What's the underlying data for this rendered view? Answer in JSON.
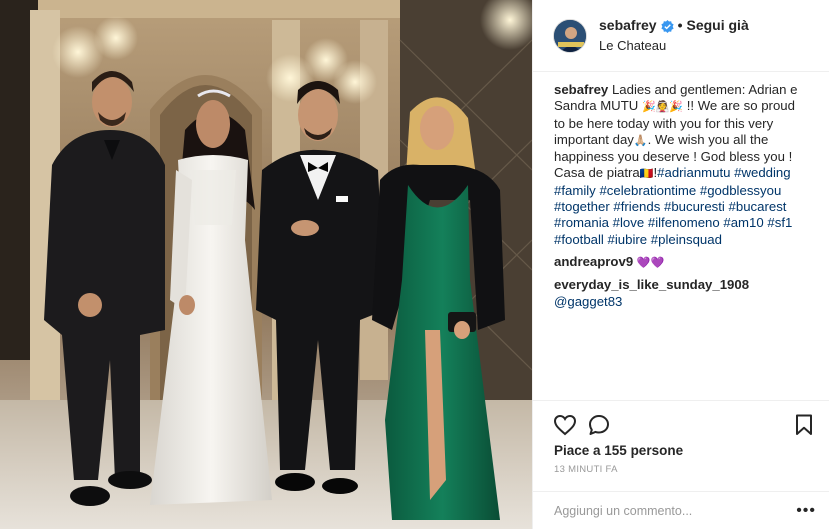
{
  "post": {
    "author": "sebafrey",
    "follow_label": "Segui già",
    "separator": "•",
    "location": "Le Chateau",
    "caption": {
      "author": "sebafrey",
      "line1": "Ladies and gentlemen: Adrian e",
      "line2_a": "Sandra MUTU ",
      "line2_emoji": "🎉👰🎉",
      "line2_b": " !! We are so proud",
      "line3": "to be here today with you for this very",
      "line4_a": "important day",
      "line4_emoji": "🙏🏼",
      "line4_b": ". We wish you all the",
      "line5": "happiness you deserve ! God bless you !",
      "line6_a": "Casa de piatra",
      "line6_emoji": "🇷🇴",
      "line6_b": "!",
      "hashtags": [
        "#adrianmutu",
        "#wedding",
        "#family",
        "#celebrationtime",
        "#godblessyou",
        "#together",
        "#friends",
        "#bucuresti",
        "#bucarest",
        "#romania",
        "#love",
        "#ilfenomeno",
        "#am10",
        "#sf1",
        "#football",
        "#iubire",
        "#pleinsquad"
      ]
    },
    "comments": [
      {
        "user": "andreaprov9",
        "text": "💜💜"
      },
      {
        "user": "everyday_is_like_sunday_1908",
        "text": "@gagget83"
      }
    ],
    "likes_text": "Piace a 155 persone",
    "timestamp": "13 minuti fa",
    "comment_placeholder": "Aggiungi un commento...",
    "more_label": "•••"
  },
  "icons": {
    "verified": "verified-badge-icon",
    "like": "heart-icon",
    "comment": "comment-bubble-icon",
    "save": "bookmark-icon"
  },
  "colors": {
    "verified": "#3897f0",
    "hashtag": "#003569",
    "muted": "#999999",
    "text": "#262626"
  }
}
